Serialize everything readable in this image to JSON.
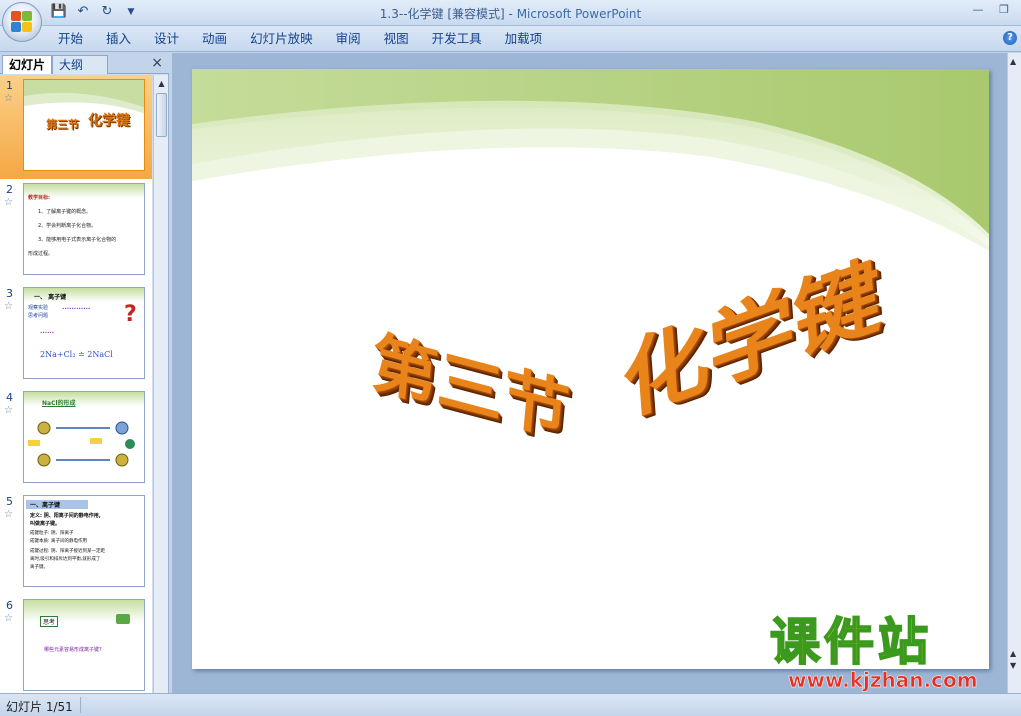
{
  "window": {
    "title_doc": "1.3--化学键 [兼容模式]",
    "title_sep": " - ",
    "title_app": "Microsoft PowerPoint"
  },
  "quick_access": [
    "save-icon",
    "undo-icon",
    "redo-icon",
    "customize-icon"
  ],
  "ribbon": {
    "tabs": [
      "开始",
      "插入",
      "设计",
      "动画",
      "幻灯片放映",
      "审阅",
      "视图",
      "开发工具",
      "加载项"
    ]
  },
  "pane": {
    "tab_slides": "幻灯片",
    "tab_outline": "大纲",
    "close": "×"
  },
  "thumbnails": [
    {
      "num": "1",
      "selected": true
    },
    {
      "num": "2",
      "lines": [
        "教学目标:",
        "1、了解离子键的概念。",
        "2、学会判断离子化合物。",
        "3、能够用电子式表示离子化合物的",
        "形成过程。"
      ]
    },
    {
      "num": "3",
      "heading": "一、 离子键",
      "lines": [
        "观察实验",
        "思考问题",
        "2Na+Cl₂ ≐ 2NaCl"
      ]
    },
    {
      "num": "4",
      "heading": "NaCl的形成"
    },
    {
      "num": "5",
      "heading": "一、离子键",
      "lines": [
        "定义: 阴、阳离子间的静电作用,",
        "叫做离子键。",
        "成键粒子: 阴、阳离子",
        "成键本质: 离子间的静电作用",
        "成键过程: 阴、阳离子接近到某一定距",
        "离时,吸引和排斥达到平衡,就形成了",
        "离子键。"
      ]
    },
    {
      "num": "6",
      "badge": "思考",
      "lines": [
        "哪些元素容易形成离子键?"
      ]
    }
  ],
  "slide": {
    "title_part1": "第三节",
    "title_part2": "化学键"
  },
  "watermark": {
    "line1": "课件站",
    "line2": "www.kjzhan.com"
  },
  "status": {
    "slide_counter": "幻灯片 1/51"
  }
}
